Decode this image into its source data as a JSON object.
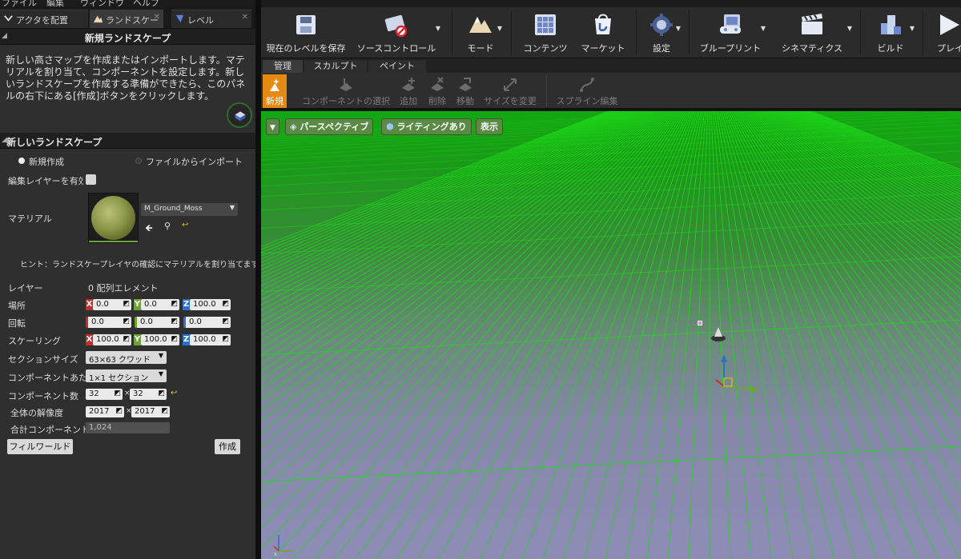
{
  "menu": [
    "ファイル",
    "編集",
    "ウィンドウ",
    "ヘルプ"
  ],
  "doc_tabs": [
    {
      "label": "アクタを配置",
      "icon": "place-actor-icon"
    },
    {
      "label": "ランドスケー",
      "icon": "landscape-icon"
    },
    {
      "label": "レベル",
      "icon": "level-icon"
    }
  ],
  "panel": {
    "title": "新規ランドスケープ",
    "description": "新しい高さマップを作成またはインポートします。マテリアルを割り当て、コンポーネントを設定します。新しいランドスケープを作成する準備ができたら、このパネルの右下にある[作成]ボタンをクリックします。",
    "section_title": "新しいランドスケープ",
    "radio_new": "新規作成",
    "radio_import": "ファイルからインポート",
    "edit_layers_label": "編集レイヤーを有効化",
    "material_label": "マテリアル",
    "material_name": "M_Ground_Moss",
    "hint": "ヒント：ランドスケープレイヤの確認にマテリアルを割り当てます",
    "layers_label": "レイヤー",
    "layers_value": "0 配列エレメント",
    "location_label": "場所",
    "location": {
      "x": "0.0",
      "y": "0.0",
      "z": "100.0"
    },
    "rotation_label": "回転",
    "rotation": {
      "x": "0.0",
      "y": "0.0",
      "z": "0.0"
    },
    "scale_label": "スケーリング",
    "scale": {
      "x": "100.0",
      "y": "100.0",
      "z": "100.0"
    },
    "section_size_label": "セクションサイズ",
    "section_size": "63×63 クワッド",
    "sections_per_component_label": "コンポーネントあたり",
    "sections_per_component": "1×1 セクション",
    "component_count_label": "コンポーネント数",
    "component_count": {
      "x": "32",
      "y": "32"
    },
    "resolution_label": "全体の解像度",
    "resolution": {
      "x": "2017",
      "y": "2017"
    },
    "total_components_label": "合計コンポーネント",
    "total_components": "1,024",
    "fill_world_button": "フィルワールド",
    "create_button": "作成"
  },
  "toolbar": [
    {
      "label": "現在のレベルを保存",
      "icon": "save-icon"
    },
    {
      "label": "ソースコントロール",
      "icon": "source-control-icon"
    },
    {
      "label": "モード",
      "icon": "modes-icon"
    },
    {
      "label": "コンテンツ",
      "icon": "content-icon"
    },
    {
      "label": "マーケット",
      "icon": "marketplace-icon"
    },
    {
      "label": "設定",
      "icon": "settings-icon"
    },
    {
      "label": "ブループリント",
      "icon": "blueprint-icon"
    },
    {
      "label": "シネマティクス",
      "icon": "cinematics-icon"
    },
    {
      "label": "ビルド",
      "icon": "build-icon"
    },
    {
      "label": "プレイ",
      "icon": "play-icon"
    }
  ],
  "mode_tabs": [
    "管理",
    "スカルプト",
    "ペイント"
  ],
  "sub_tools": [
    "新規",
    "コンポーネントの選択",
    "追加",
    "削除",
    "移動",
    "サイズを変更",
    "スプライン編集"
  ],
  "viewport": {
    "view_mode": "パースペクティブ",
    "lighting": "ライティングあり",
    "show": "表示",
    "grid_color": "#14a812"
  },
  "colors": {
    "accent": "#e48a10",
    "axis_x": "#c62e2e",
    "axis_y": "#6aa82a",
    "axis_z": "#2d6fc9"
  }
}
